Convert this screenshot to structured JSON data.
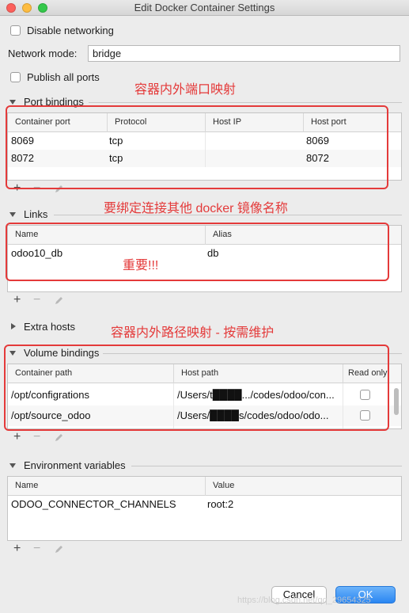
{
  "window": {
    "title": "Edit Docker Container Settings"
  },
  "disable_networking": {
    "label": "Disable networking",
    "checked": false
  },
  "network_mode": {
    "label": "Network mode:",
    "value": "bridge"
  },
  "publish_all_ports": {
    "label": "Publish all ports",
    "checked": false
  },
  "port_bindings": {
    "title": "Port bindings",
    "columns": [
      "Container port",
      "Protocol",
      "Host IP",
      "Host port"
    ],
    "rows": [
      [
        "8069",
        "tcp",
        "",
        "8069"
      ],
      [
        "8072",
        "tcp",
        "",
        "8072"
      ]
    ]
  },
  "links": {
    "title": "Links",
    "columns": [
      "Name",
      "Alias"
    ],
    "rows": [
      [
        "odoo10_db",
        "db"
      ]
    ]
  },
  "extra_hosts": {
    "title": "Extra hosts"
  },
  "volume_bindings": {
    "title": "Volume bindings",
    "columns": [
      "Container path",
      "Host path",
      "Read only"
    ],
    "rows": [
      [
        "/opt/configrations",
        "/Users/t████.../codes/odoo/con..."
      ],
      [
        "/opt/source_odoo",
        "/Users/████s/codes/odoo/odo..."
      ]
    ]
  },
  "environment_variables": {
    "title": "Environment variables",
    "columns": [
      "Name",
      "Value"
    ],
    "rows": [
      [
        "ODOO_CONNECTOR_CHANNELS",
        "root:2"
      ]
    ]
  },
  "toolbar": {
    "add": "+",
    "remove": "−"
  },
  "annotations": {
    "port_mapping": "容器内外端口映射",
    "link_note": "要绑定连接其他 docker 镜像名称",
    "important": "重要!!!",
    "path_mapping": "容器内外路径映射 - 按需维护"
  },
  "buttons": {
    "cancel": "Cancel",
    "ok": "OK"
  },
  "watermark": "https://blog.csdn.net/qq_29654325",
  "colors": {
    "annotation": "#e43a3a",
    "primary_button": "#2a86f2"
  }
}
